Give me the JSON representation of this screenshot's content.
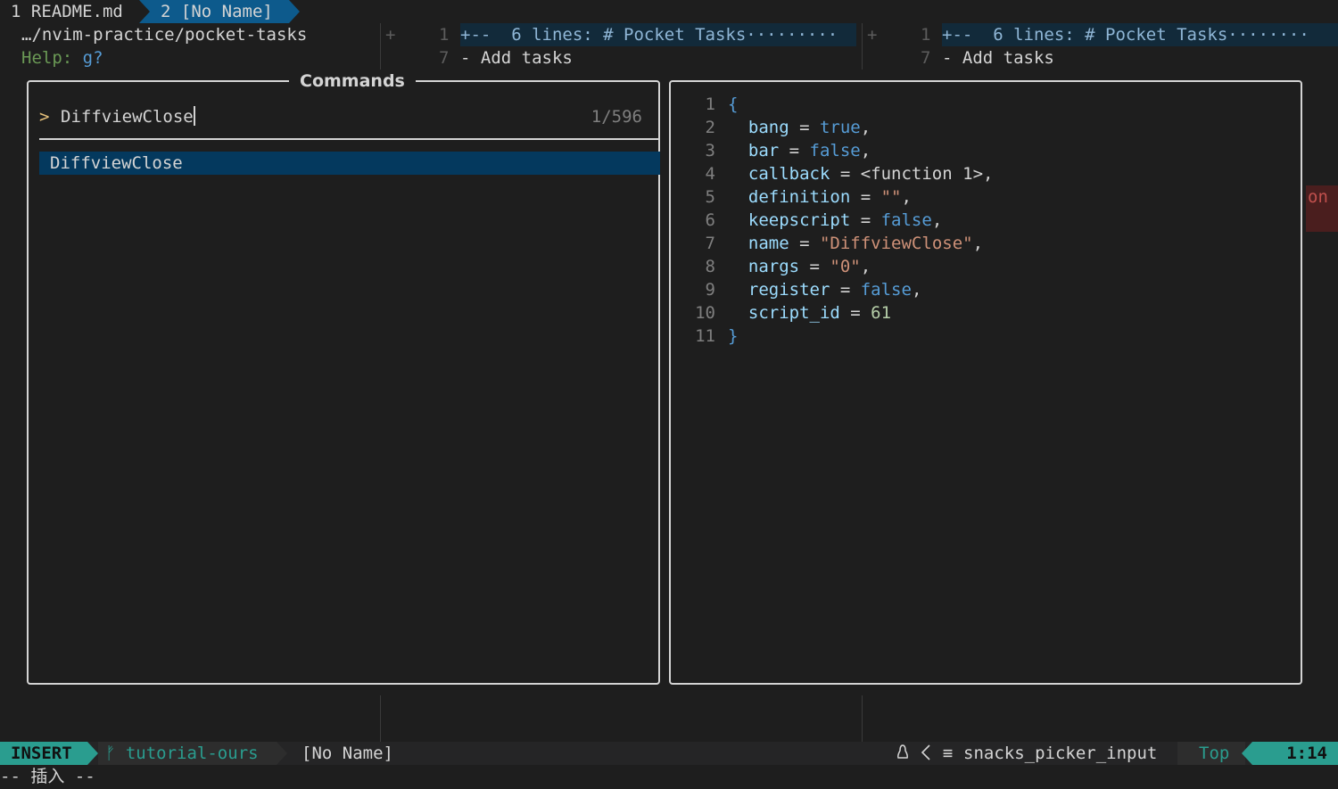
{
  "tabline": {
    "tab1": "1 README.md",
    "tab2": "2 [No Name]"
  },
  "left_window": {
    "path": "…/nvim-practice/pocket-tasks",
    "help_label": "Help:",
    "help_key": "g?"
  },
  "diff_panes": [
    {
      "sign": "+",
      "fold_num": "1",
      "fold_text": "+--  6 lines: # Pocket Tasks·········",
      "line_num": "7",
      "line_text": "- Add tasks"
    },
    {
      "sign": "+",
      "fold_num": "1",
      "fold_text": "+--  6 lines: # Pocket Tasks········",
      "line_num": "7",
      "line_text": "- Add tasks"
    }
  ],
  "picker": {
    "title": "Commands",
    "prompt_icon": ">",
    "query": "DiffviewClose",
    "counter": "1/596",
    "results": [
      "DiffviewClose"
    ]
  },
  "preview": {
    "lines": [
      {
        "n": "1",
        "open": "{"
      },
      {
        "n": "2",
        "key": "bang",
        "val": "true",
        "type": "bool"
      },
      {
        "n": "3",
        "key": "bar",
        "val": "false",
        "type": "bool"
      },
      {
        "n": "4",
        "key": "callback",
        "val": "<function 1>",
        "type": "plain"
      },
      {
        "n": "5",
        "key": "definition",
        "val": "\"\"",
        "type": "str"
      },
      {
        "n": "6",
        "key": "keepscript",
        "val": "false",
        "type": "bool"
      },
      {
        "n": "7",
        "key": "name",
        "val": "\"DiffviewClose\"",
        "type": "str"
      },
      {
        "n": "8",
        "key": "nargs",
        "val": "\"0\"",
        "type": "str"
      },
      {
        "n": "9",
        "key": "register",
        "val": "false",
        "type": "bool"
      },
      {
        "n": "10",
        "key": "script_id",
        "val": "61",
        "type": "num"
      },
      {
        "n": "11",
        "close": "}"
      }
    ]
  },
  "right_edge_text": "on",
  "statusline": {
    "mode": "INSERT",
    "branch_icon": "ᚠ",
    "branch": "tutorial-ours",
    "filename": "[No Name]",
    "os_icon": "linux-icon",
    "filetype_icon": "≡",
    "filetype": "snacks_picker_input",
    "position": "Top",
    "cursor": "1:14"
  },
  "cmdline": "-- 插入 --"
}
